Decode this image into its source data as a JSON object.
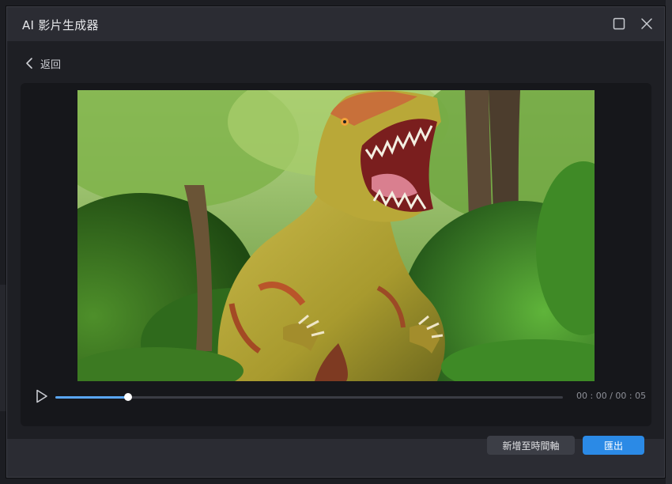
{
  "window": {
    "title": "AI 影片生成器",
    "maximize_icon": "maximize-icon",
    "close_icon": "close-icon"
  },
  "nav": {
    "back_label": "返回",
    "back_icon": "chevron-left-icon"
  },
  "player": {
    "play_icon": "play-icon",
    "current_time": "00 : 00",
    "total_time": "00 : 05",
    "timecode": "00 : 00 / 00 : 05",
    "progress": 0.144,
    "accent_color": "#5aa6f5",
    "video_subject": "dinosaur"
  },
  "footer": {
    "add_to_timeline_label": "新增至時間軸",
    "export_label": "匯出",
    "primary_color": "#2b8ae6"
  }
}
